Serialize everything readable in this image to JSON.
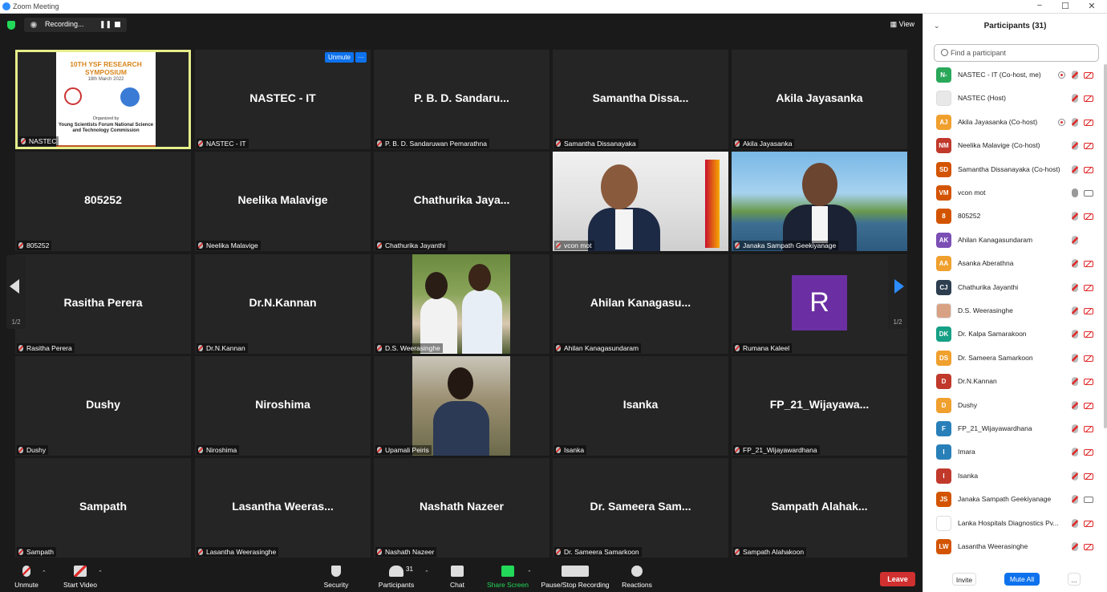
{
  "window": {
    "title": "Zoom Meeting",
    "controls": [
      "−",
      "☐",
      "✕"
    ]
  },
  "topbar": {
    "recording_label": "Recording...",
    "view_label": "View"
  },
  "tiles": [
    {
      "name": "NASTEC",
      "big": ""
    },
    {
      "name": "NASTEC - IT",
      "big": "NASTEC - IT"
    },
    {
      "name": "P. B. D. Sandaruwan Pemarathna",
      "big": "P. B. D. Sandaru..."
    },
    {
      "name": "Samantha Dissanayaka",
      "big": "Samantha  Dissa..."
    },
    {
      "name": "Akila Jayasanka",
      "big": "Akila Jayasanka"
    },
    {
      "name": "805252",
      "big": "805252"
    },
    {
      "name": "Neelika Malavige",
      "big": "Neelika Malavige"
    },
    {
      "name": "Chathurika Jayanthi",
      "big": "Chathurika  Jaya..."
    },
    {
      "name": "vcon mot",
      "big": ""
    },
    {
      "name": "Janaka Sampath Geekiyanage",
      "big": ""
    },
    {
      "name": "Rasitha Perera",
      "big": "Rasitha Perera"
    },
    {
      "name": "Dr.N.Kannan",
      "big": "Dr.N.Kannan"
    },
    {
      "name": "D.S. Weerasinghe",
      "big": ""
    },
    {
      "name": "Ahilan Kanagasundaram",
      "big": "Ahilan  Kanagasu..."
    },
    {
      "name": "Rumana Kaleel",
      "big": ""
    },
    {
      "name": "Dushy",
      "big": "Dushy"
    },
    {
      "name": "Niroshima",
      "big": "Niroshima"
    },
    {
      "name": "Upamali Peiris",
      "big": ""
    },
    {
      "name": "Isanka",
      "big": "Isanka"
    },
    {
      "name": "FP_21_Wijayawardhana",
      "big": "FP_21_Wijayawa..."
    },
    {
      "name": "Sampath",
      "big": "Sampath"
    },
    {
      "name": "Lasantha Weerasinghe",
      "big": "Lasantha  Weeras..."
    },
    {
      "name": "Nashath Nazeer",
      "big": "Nashath Nazeer"
    },
    {
      "name": "Dr. Sameera Samarkoon",
      "big": "Dr. Sameera  Sam..."
    },
    {
      "name": "Sampath Alahakoon",
      "big": "Sampath  Alahak..."
    }
  ],
  "slide": {
    "title1": "10TH YSF RESEARCH",
    "title2": "SYMPOSIUM",
    "date": "18th March 2022",
    "org_intro": "Organized by",
    "org": "Young Scientists Forum National Science and Technology Commission"
  },
  "tile_controls": {
    "unmute": "Unmute",
    "more": "···"
  },
  "avatar_letter": "R",
  "pager": {
    "left": "1/2",
    "right": "1/2"
  },
  "toolbar": {
    "unmute": "Unmute",
    "start_video": "Start Video",
    "security": "Security",
    "participants": "Participants",
    "participants_count": "31",
    "chat": "Chat",
    "share_screen": "Share Screen",
    "pause_stop_recording": "Pause/Stop Recording",
    "reactions": "Reactions",
    "leave": "Leave"
  },
  "panel": {
    "title": "Participants (31)",
    "search_placeholder": "Find a participant",
    "invite": "Invite",
    "mute_all": "Mute All",
    "more": "..."
  },
  "participants": [
    {
      "initials": "N-",
      "name": "NASTEC - IT (Co-host, me)",
      "color": "#2aa85a",
      "rec": true,
      "mic": "muted",
      "video": "off"
    },
    {
      "initials": "",
      "name": "NASTEC (Host)",
      "color": "#e8e8e8",
      "rec": false,
      "mic": "muted",
      "video": "off"
    },
    {
      "initials": "AJ",
      "name": "Akila Jayasanka (Co-host)",
      "color": "#f0a02e",
      "rec": true,
      "mic": "muted",
      "video": "off"
    },
    {
      "initials": "NM",
      "name": "Neelika Malavige (Co-host)",
      "color": "#c0392b",
      "rec": false,
      "mic": "muted",
      "video": "off"
    },
    {
      "initials": "SD",
      "name": "Samantha Dissanayaka (Co-host)",
      "color": "#d35400",
      "rec": false,
      "mic": "muted",
      "video": "off"
    },
    {
      "initials": "VM",
      "name": "vcon mot",
      "color": "#d35400",
      "rec": false,
      "mic": "on",
      "video": "on"
    },
    {
      "initials": "8",
      "name": "805252",
      "color": "#d35400",
      "rec": false,
      "mic": "muted",
      "video": "off"
    },
    {
      "initials": "AK",
      "name": "Ahilan Kanagasundaram",
      "color": "#7b4fb5",
      "rec": false,
      "mic": "muted",
      "video": "none"
    },
    {
      "initials": "AA",
      "name": "Asanka Aberathna",
      "color": "#f0a02e",
      "rec": false,
      "mic": "muted",
      "video": "off"
    },
    {
      "initials": "CJ",
      "name": "Chathurika Jayanthi",
      "color": "#2c3e50",
      "rec": false,
      "mic": "muted",
      "video": "off"
    },
    {
      "initials": "",
      "name": "D.S. Weerasinghe",
      "color": "#d9a184",
      "rec": false,
      "mic": "muted",
      "video": "off"
    },
    {
      "initials": "DK",
      "name": "Dr. Kalpa Samarakoon",
      "color": "#16a085",
      "rec": false,
      "mic": "muted",
      "video": "off"
    },
    {
      "initials": "DS",
      "name": "Dr. Sameera Samarkoon",
      "color": "#f0a02e",
      "rec": false,
      "mic": "muted",
      "video": "off"
    },
    {
      "initials": "D",
      "name": "Dr.N.Kannan",
      "color": "#c0392b",
      "rec": false,
      "mic": "muted",
      "video": "off"
    },
    {
      "initials": "D",
      "name": "Dushy",
      "color": "#f0a02e",
      "rec": false,
      "mic": "muted",
      "video": "off"
    },
    {
      "initials": "F",
      "name": "FP_21_Wijayawardhana",
      "color": "#2980b9",
      "rec": false,
      "mic": "muted",
      "video": "off"
    },
    {
      "initials": "I",
      "name": "Imara",
      "color": "#2980b9",
      "rec": false,
      "mic": "muted",
      "video": "off"
    },
    {
      "initials": "I",
      "name": "Isanka",
      "color": "#c0392b",
      "rec": false,
      "mic": "muted",
      "video": "off"
    },
    {
      "initials": "JS",
      "name": "Janaka Sampath Geekiyanage",
      "color": "#d35400",
      "rec": false,
      "mic": "muted",
      "video": "on"
    },
    {
      "initials": "",
      "name": "Lanka Hospitals Diagnostics Pv...",
      "color": "#ffffff",
      "rec": false,
      "mic": "muted",
      "video": "off"
    },
    {
      "initials": "LW",
      "name": "Lasantha Weerasinghe",
      "color": "#d35400",
      "rec": false,
      "mic": "muted",
      "video": "off"
    }
  ]
}
